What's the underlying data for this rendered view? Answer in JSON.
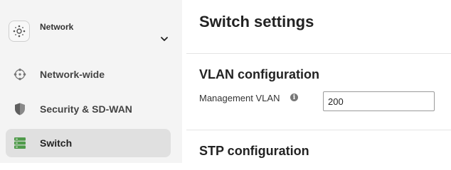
{
  "sidebar": {
    "network_selector": {
      "label": "Network",
      "icon": "network-nodes-icon",
      "chevron": "chevron-down-icon"
    },
    "items": [
      {
        "label": "Network-wide",
        "icon": "network-wide-icon",
        "active": false
      },
      {
        "label": "Security & SD-WAN",
        "icon": "shield-icon",
        "active": false
      },
      {
        "label": "Switch",
        "icon": "switch-icon",
        "active": true
      }
    ]
  },
  "main": {
    "title": "Switch settings",
    "sections": [
      {
        "title": "VLAN configuration"
      },
      {
        "title": "STP configuration"
      }
    ],
    "management_vlan": {
      "label": "Management VLAN",
      "info_icon": "info-icon",
      "value": "200"
    }
  },
  "colors": {
    "sidebar_bg": "#f4f4f4",
    "active_item_bg": "#e0e0e0",
    "switch_icon_green": "#4f9a4a"
  }
}
